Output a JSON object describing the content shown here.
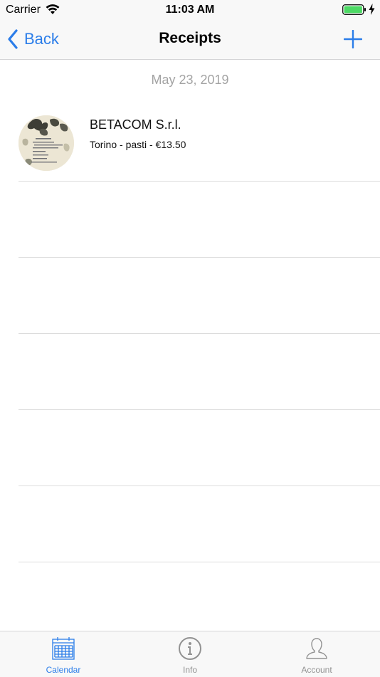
{
  "status_bar": {
    "carrier": "Carrier",
    "time": "11:03 AM",
    "wifi_icon": "wifi-icon",
    "battery_icon": "battery-full-icon",
    "charging_icon": "charging-bolt-icon",
    "battery_level": 1.0
  },
  "nav": {
    "back_label": "Back",
    "title": "Receipts",
    "back_icon": "chevron-left-icon",
    "add_icon": "plus-icon"
  },
  "section": {
    "date": "May 23, 2019"
  },
  "receipts": [
    {
      "title": "BETACOM S.r.l.",
      "subtitle": "Torino - pasti - €13.50",
      "thumb_icon": "receipt-photo-thumbnail"
    }
  ],
  "tabs": [
    {
      "label": "Calendar",
      "icon": "calendar-icon",
      "selected": true
    },
    {
      "label": "Info",
      "icon": "info-icon",
      "selected": false
    },
    {
      "label": "Account",
      "icon": "person-icon",
      "selected": false
    }
  ],
  "colors": {
    "accent": "#2b7de9",
    "tab_inactive": "#929292",
    "section_text": "#a3a3a3",
    "bar_background": "#f8f8f8",
    "battery_green": "#4cd964"
  }
}
